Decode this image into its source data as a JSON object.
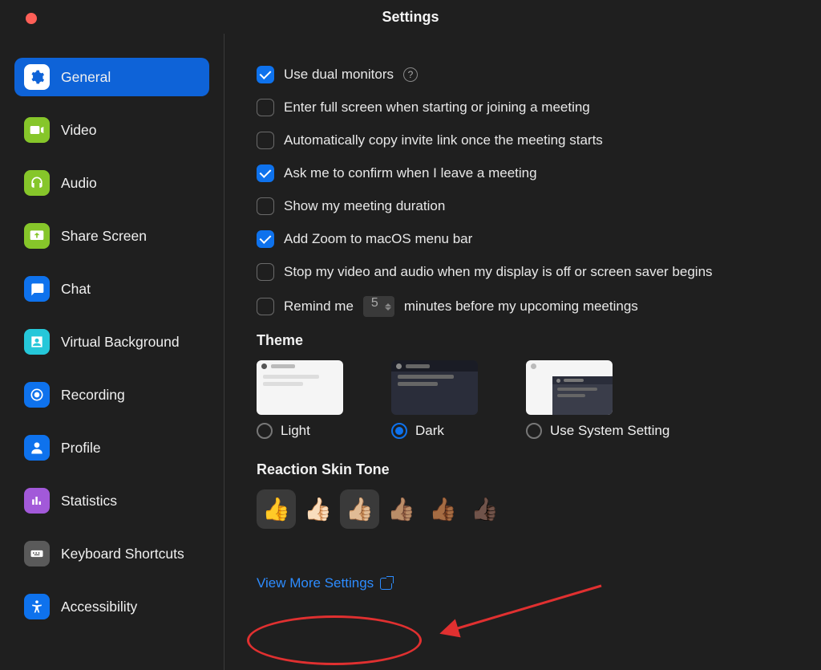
{
  "title": "Settings",
  "sidebar": {
    "items": [
      {
        "label": "General",
        "icon_bg": "#0e63d8",
        "active": true
      },
      {
        "label": "Video",
        "icon_bg": "#86c62a",
        "active": false
      },
      {
        "label": "Audio",
        "icon_bg": "#86c62a",
        "active": false
      },
      {
        "label": "Share Screen",
        "icon_bg": "#86c62a",
        "active": false
      },
      {
        "label": "Chat",
        "icon_bg": "#0e72ed",
        "active": false
      },
      {
        "label": "Virtual Background",
        "icon_bg": "#0e72ed",
        "active": false
      },
      {
        "label": "Recording",
        "icon_bg": "#0e72ed",
        "active": false
      },
      {
        "label": "Profile",
        "icon_bg": "#0e72ed",
        "active": false
      },
      {
        "label": "Statistics",
        "icon_bg": "#a259d9",
        "active": false
      },
      {
        "label": "Keyboard Shortcuts",
        "icon_bg": "#5a5a5a",
        "active": false
      },
      {
        "label": "Accessibility",
        "icon_bg": "#0e72ed",
        "active": false
      }
    ]
  },
  "options": {
    "dual_monitors": {
      "label": "Use dual monitors",
      "checked": true
    },
    "full_screen": {
      "label": "Enter full screen when starting or joining a meeting",
      "checked": false
    },
    "copy_invite": {
      "label": "Automatically copy invite link once the meeting starts",
      "checked": false
    },
    "confirm_leave": {
      "label": "Ask me to confirm when I leave a meeting",
      "checked": true
    },
    "show_duration": {
      "label": "Show my meeting duration",
      "checked": false
    },
    "menu_bar": {
      "label": "Add Zoom to macOS menu bar",
      "checked": true
    },
    "stop_video": {
      "label": "Stop my video and audio when my display is off or screen saver begins",
      "checked": false
    },
    "remind": {
      "label_before": "Remind me",
      "value": "5",
      "label_after": "minutes before my upcoming meetings",
      "checked": false
    }
  },
  "theme": {
    "section_title": "Theme",
    "options": [
      {
        "label": "Light",
        "selected": false
      },
      {
        "label": "Dark",
        "selected": true
      },
      {
        "label": "Use System Setting",
        "selected": false
      }
    ]
  },
  "skin": {
    "section_title": "Reaction Skin Tone",
    "tones": [
      "👍",
      "👍🏻",
      "👍🏼",
      "👍🏽",
      "👍🏾",
      "👍🏿"
    ],
    "selected_index": 0
  },
  "view_more": "View More Settings"
}
